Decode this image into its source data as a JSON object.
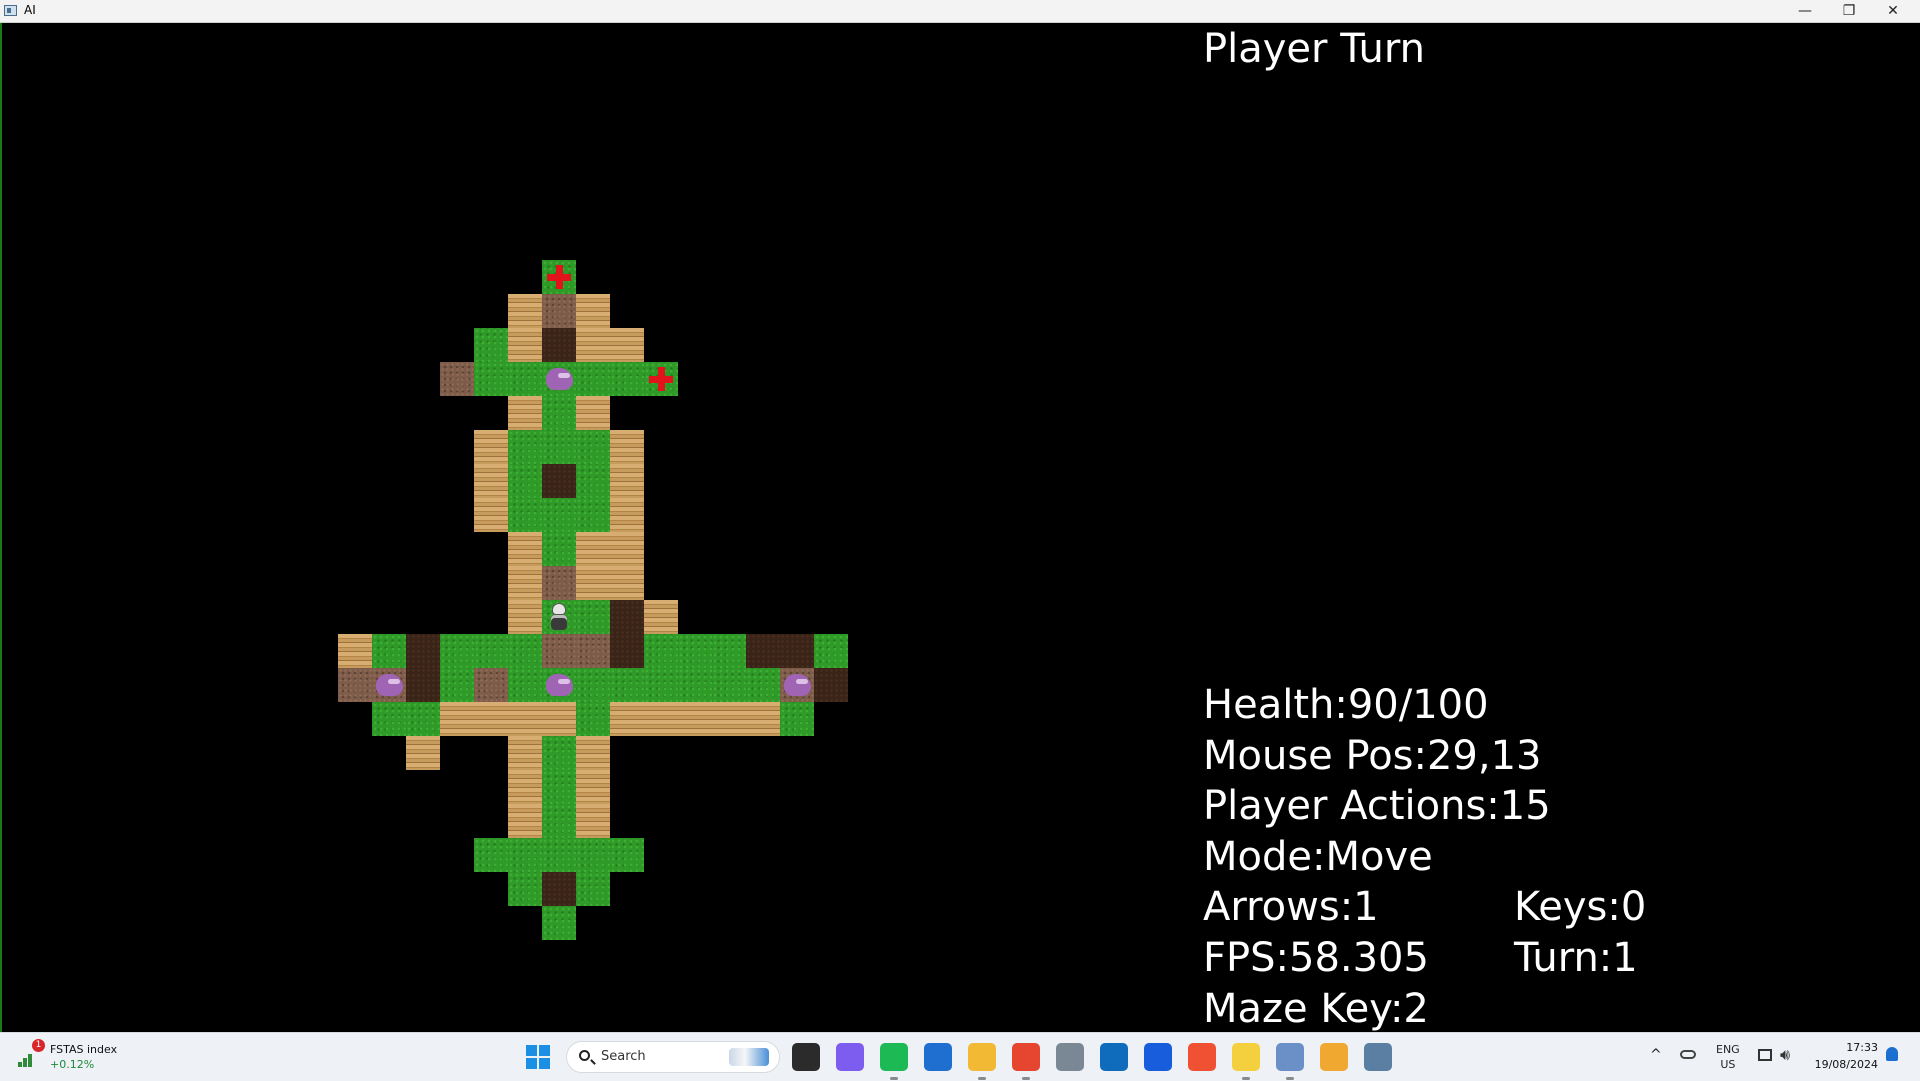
{
  "window": {
    "title": "AI",
    "controls": {
      "minimize": "—",
      "maximize": "❐",
      "close": "✕"
    }
  },
  "hud": {
    "turn_status": "Player Turn",
    "health": "Health:90/100",
    "mouse_pos": "Mouse Pos:29,13",
    "player_actions": "Player Actions:15",
    "mode": "Mode:Move",
    "arrows": "Arrows:1",
    "keys": "Keys:0",
    "fps": "FPS:58.305",
    "turn": "Turn:1",
    "maze_key": "Maze Key:2"
  },
  "map": {
    "legend": {
      "G": "grass",
      "W": "wood-wall",
      "D": "dirt",
      "P": "pit",
      ".": "void"
    },
    "rows": [
      ".......G.......",
      "......WDW......",
      ".....GWPWW.....",
      "....DGGGGGG....",
      "......WGW......",
      ".....WGGGW.....",
      ".....WGPGW.....",
      ".....WGGGW.....",
      "......WGWW.....",
      "......WDWW.....",
      "......WGGPW....",
      ".WGPGGGDDPGGGPPG",
      ".DDPGDGGGGGGGGDP",
      "..GGWWWWGWWWWWG.",
      "...W..WGW.......",
      "......WGW.......",
      "......WGW.......",
      ".....GGGGG......",
      "......GPG.......",
      ".......G........"
    ],
    "entities": [
      {
        "type": "health-pack",
        "row": 0,
        "col": 7
      },
      {
        "type": "health-pack",
        "row": 3,
        "col": 10
      },
      {
        "type": "monster",
        "row": 3,
        "col": 7
      },
      {
        "type": "monster",
        "row": 12,
        "col": 2
      },
      {
        "type": "monster",
        "row": 12,
        "col": 7
      },
      {
        "type": "monster",
        "row": 12,
        "col": 14
      },
      {
        "type": "player",
        "row": 10,
        "col": 7
      }
    ]
  },
  "taskbar": {
    "widget": {
      "badge": "1",
      "name": "FSTAS index",
      "change": "+0.12%"
    },
    "search_placeholder": "Search",
    "apps": [
      {
        "icon": "file-explorer-dark-icon",
        "color": "#2b2b2b",
        "state": ""
      },
      {
        "icon": "copilot-icon",
        "color": "#7d5cf0",
        "state": ""
      },
      {
        "icon": "spotify-icon",
        "color": "#1db954",
        "state": "running"
      },
      {
        "icon": "remote-desktop-icon",
        "color": "#1f6fd1",
        "state": ""
      },
      {
        "icon": "file-explorer-icon",
        "color": "#f2b935",
        "state": "running"
      },
      {
        "icon": "chrome-icon",
        "color": "#e6452f",
        "state": "running"
      },
      {
        "icon": "calculator-icon",
        "color": "#7a8896",
        "state": ""
      },
      {
        "icon": "outlook-icon",
        "color": "#0f6cbd",
        "state": ""
      },
      {
        "icon": "bitwarden-icon",
        "color": "#175ddc",
        "state": ""
      },
      {
        "icon": "git-icon",
        "color": "#f05133",
        "state": ""
      },
      {
        "icon": "sticky-notes-icon",
        "color": "#f4d03f",
        "state": "running"
      },
      {
        "icon": "r-icon",
        "color": "#6b8fc7",
        "state": "running"
      },
      {
        "icon": "chrome-canary-icon",
        "color": "#f0a830",
        "state": ""
      },
      {
        "icon": "game-window-icon",
        "color": "#5a7fa3",
        "state": "active"
      }
    ],
    "tray": {
      "lang_top": "ENG",
      "lang_bottom": "US",
      "time": "17:33",
      "date": "19/08/2024"
    }
  }
}
